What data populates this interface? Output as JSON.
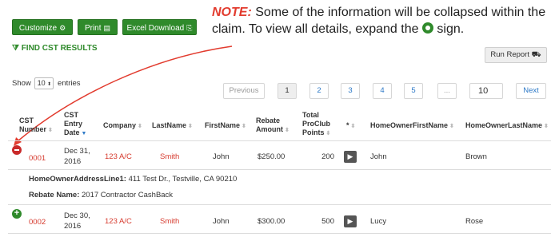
{
  "toolbar": {
    "customize_label": "Customize",
    "print_label": "Print",
    "excel_label": "Excel Download"
  },
  "note": {
    "prefix": "NOTE:",
    "text_before": "Some of the information will be collapsed within the claim. To view all details, expand the",
    "text_after": "sign."
  },
  "find_results_label": "FIND CST RESULTS",
  "run_report_label": "Run Report",
  "entries": {
    "show_label": "Show",
    "value": "10",
    "suffix_label": "entries"
  },
  "pagination": {
    "previous": "Previous",
    "pages": [
      "1",
      "2",
      "3",
      "4",
      "5"
    ],
    "ellipsis": "...",
    "last": "10",
    "next": "Next"
  },
  "columns": [
    "CST Number",
    "CST Entry Date",
    "Company",
    "LastName",
    "FirstName",
    "Rebate Amount",
    "Total ProClub Points",
    "*",
    "HomeOwnerFirstName",
    "HomeOwnerLastName"
  ],
  "rows": [
    {
      "cst_number": "0001",
      "date_line1": "Dec 31,",
      "date_line2": "2016",
      "company": "123 A/C",
      "last_name": "Smith",
      "first_name": "John",
      "rebate": "$250.00",
      "points": "200",
      "ho_first": "John",
      "ho_last": "Brown",
      "expanded": true
    },
    {
      "cst_number": "0002",
      "date_line1": "Dec 30,",
      "date_line2": "2016",
      "company": "123 A/C",
      "last_name": "Smith",
      "first_name": "John",
      "rebate": "$300.00",
      "points": "500",
      "ho_first": "Lucy",
      "ho_last": "Rose",
      "expanded": false
    }
  ],
  "details": {
    "address_label": "HomeOwnerAddressLine1:",
    "address_value": "411 Test Dr., Testville, CA 90210",
    "rebate_name_label": "Rebate Name:",
    "rebate_name_value": "2017 Contractor CashBack"
  },
  "colors": {
    "green": "#2f8a2b",
    "red": "#d63a2e",
    "note_red": "#e23b2e",
    "link_blue": "#2d79c7"
  }
}
